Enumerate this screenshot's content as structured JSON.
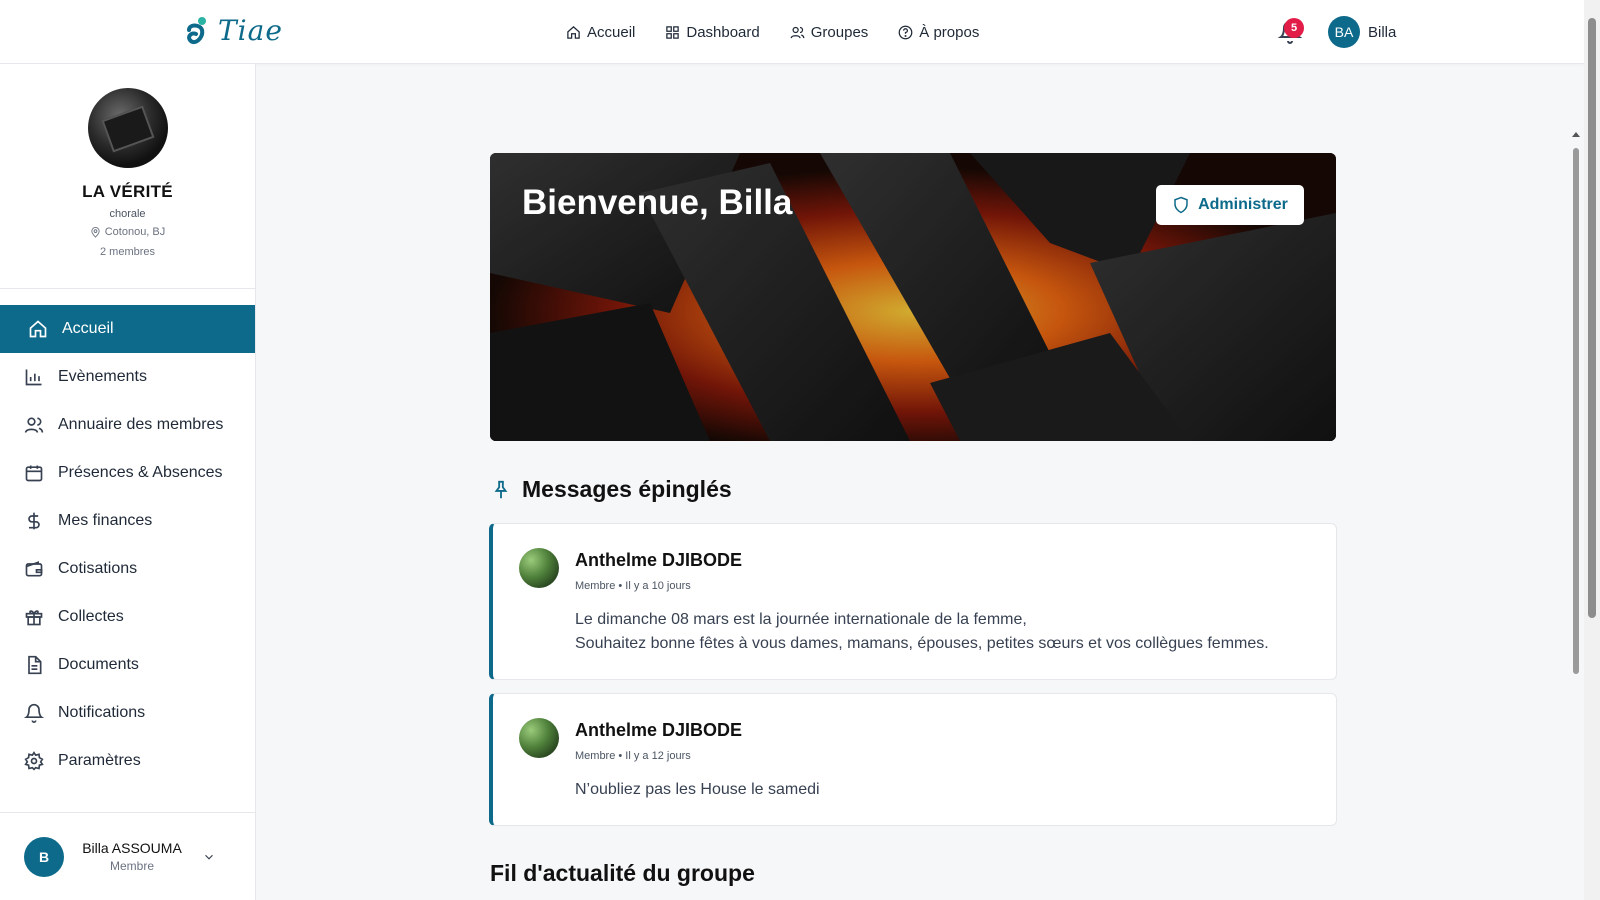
{
  "app": {
    "name": "Tiae"
  },
  "topnav": {
    "items": [
      {
        "label": "Accueil",
        "icon": "home-icon"
      },
      {
        "label": "Dashboard",
        "icon": "grid-icon"
      },
      {
        "label": "Groupes",
        "icon": "users-icon"
      },
      {
        "label": "À propos",
        "icon": "help-circle-icon"
      }
    ],
    "notifications_count": "5",
    "user_initials": "BA",
    "user_name": "Billa"
  },
  "group": {
    "name": "LA VÉRITÉ",
    "type": "chorale",
    "location": "Cotonou, BJ",
    "members": "2 membres"
  },
  "sidebar": {
    "items": [
      {
        "label": "Accueil",
        "icon": "home-icon",
        "active": true
      },
      {
        "label": "Evènements",
        "icon": "bar-chart-icon"
      },
      {
        "label": "Annuaire des membres",
        "icon": "users-icon"
      },
      {
        "label": "Présences & Absences",
        "icon": "calendar-icon"
      },
      {
        "label": "Mes finances",
        "icon": "dollar-icon"
      },
      {
        "label": "Cotisations",
        "icon": "wallet-icon"
      },
      {
        "label": "Collectes",
        "icon": "gift-icon"
      },
      {
        "label": "Documents",
        "icon": "document-icon"
      },
      {
        "label": "Notifications",
        "icon": "bell-icon"
      },
      {
        "label": "Paramètres",
        "icon": "gear-icon"
      }
    ],
    "footer": {
      "initial": "B",
      "name": "Billa ASSOUMA",
      "role": "Membre"
    }
  },
  "hero": {
    "title": "Bienvenue, Billa",
    "admin_button": "Administrer"
  },
  "pinned": {
    "title": "Messages épinglés",
    "posts": [
      {
        "author": "Anthelme DJIBODE",
        "meta": "Membre • Il y a 10 jours",
        "lines": [
          "Le dimanche 08 mars est la journée internationale de la femme,",
          "Souhaitez bonne fêtes à vous dames, mamans, épouses, petites sœurs et vos collègues femmes."
        ]
      },
      {
        "author": "Anthelme DJIBODE",
        "meta": "Membre • Il y a 12 jours",
        "lines": [
          "N’oubliez pas les House le samedi"
        ]
      }
    ]
  },
  "feed": {
    "title": "Fil d'actualité du groupe"
  },
  "colors": {
    "accent": "#0e6a8a",
    "badge": "#e11d48"
  }
}
